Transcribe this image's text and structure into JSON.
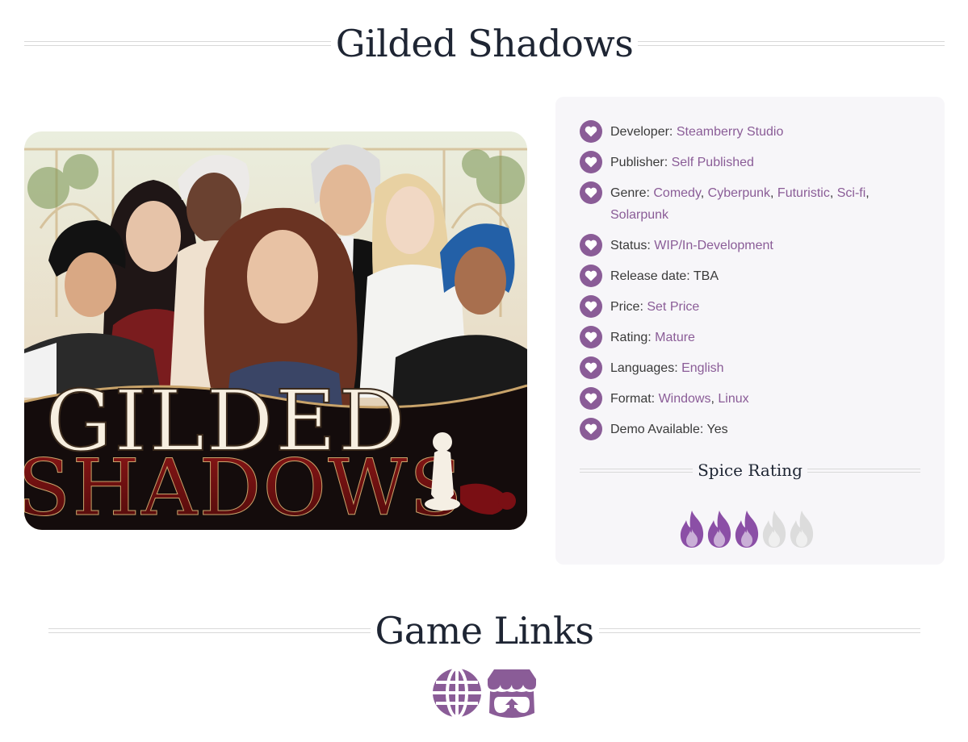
{
  "page": {
    "title": "Gilded Shadows"
  },
  "cover": {
    "logo_line1": "GILDED",
    "logo_line2": "SHADOWS",
    "colors": {
      "sky": "#eef0e3",
      "gold": "#c8a36a",
      "dark": "#140c0c",
      "crimson": "#6e1414",
      "cream": "#f7efe0"
    }
  },
  "info": [
    {
      "label": "Developer:",
      "values": [
        "Steamberry Studio"
      ]
    },
    {
      "label": "Publisher:",
      "values": [
        "Self Published"
      ]
    },
    {
      "label": "Genre:",
      "values": [
        "Comedy",
        "Cyberpunk",
        "Futuristic",
        "Sci-fi",
        "Solarpunk"
      ]
    },
    {
      "label": "Status:",
      "values": [
        "WIP/In-Development"
      ]
    },
    {
      "label": "Release date:",
      "plain": "TBA"
    },
    {
      "label": "Price:",
      "values": [
        "Set Price"
      ]
    },
    {
      "label": "Rating:",
      "values": [
        "Mature"
      ]
    },
    {
      "label": "Languages:",
      "values": [
        "English"
      ]
    },
    {
      "label": "Format:",
      "values": [
        "Windows",
        "Linux"
      ]
    },
    {
      "label": "Demo Available:",
      "plain": "Yes"
    }
  ],
  "spice": {
    "heading": "Spice Rating",
    "rating": 3,
    "max": 5,
    "active_color": "#8b4fa6",
    "inactive_color": "#dcdcdc"
  },
  "links": {
    "heading": "Game Links",
    "items": [
      {
        "icon": "globe-icon"
      },
      {
        "icon": "itchio-icon"
      }
    ],
    "color": "#8a5c97"
  },
  "colors": {
    "accent": "#8a5c97",
    "card_bg": "#f7f6f9",
    "heading": "#1e2533"
  }
}
